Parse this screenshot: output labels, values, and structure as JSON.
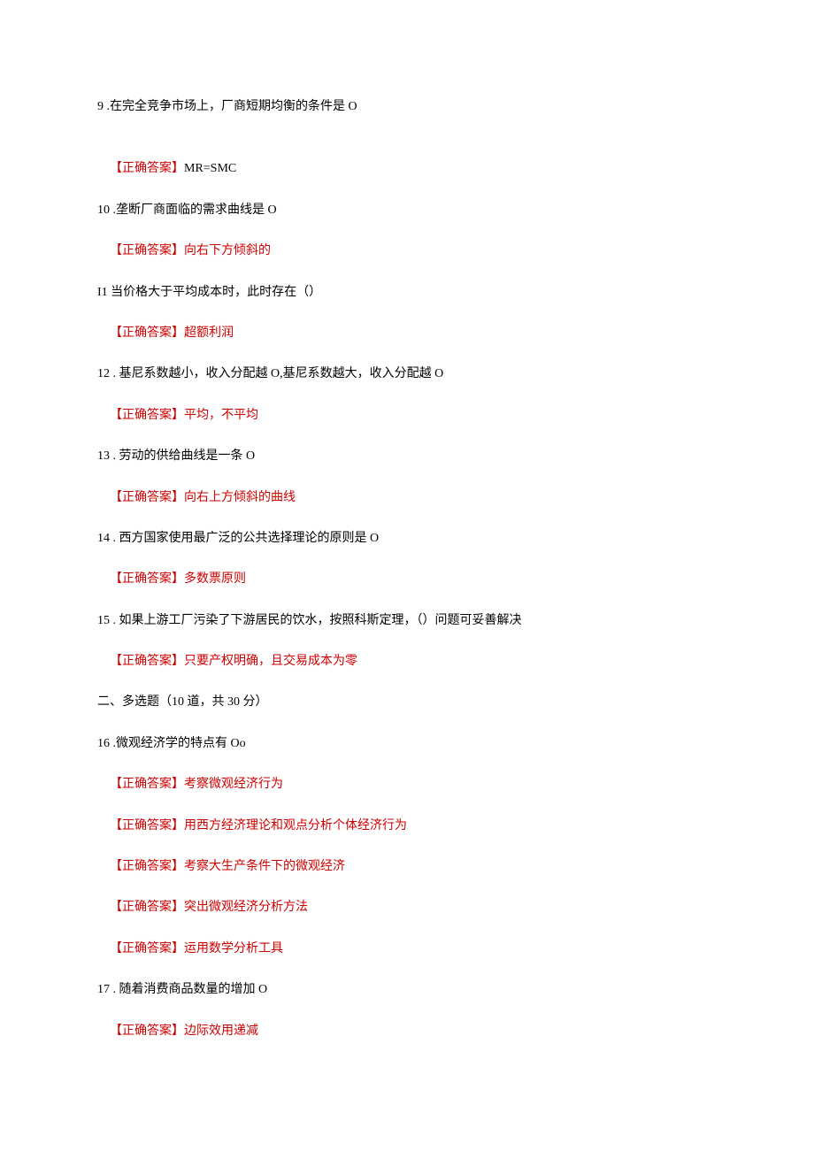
{
  "answer_label": "【正确答案】",
  "items": [
    {
      "type": "question",
      "number": "9",
      "text": " .在完全竞争市场上，厂商短期均衡的条件是 O",
      "extra_gap": true
    },
    {
      "type": "answer",
      "text": "MR=SMC",
      "red": false
    },
    {
      "type": "question",
      "number": "10",
      "text": " .垄断厂商面临的需求曲线是 O"
    },
    {
      "type": "answer",
      "text": "向右下方倾斜的",
      "red": true
    },
    {
      "type": "question",
      "number": "I1",
      "text": " 当价格大于平均成本时，此时存在（）"
    },
    {
      "type": "answer",
      "text": "超额利润",
      "red": true
    },
    {
      "type": "question",
      "number": "12",
      "text": " . 基尼系数越小，收入分配越 O,基尼系数越大，收入分配越 O"
    },
    {
      "type": "answer",
      "text": "平均，不平均",
      "red": true
    },
    {
      "type": "question",
      "number": "13",
      "text": " . 劳动的供给曲线是一条 O"
    },
    {
      "type": "answer",
      "text": "向右上方倾斜的曲线",
      "red": true
    },
    {
      "type": "question",
      "number": "14",
      "text": " . 西方国家使用最广泛的公共选择理论的原则是 O"
    },
    {
      "type": "answer",
      "text": "多数票原则",
      "red": true
    },
    {
      "type": "question",
      "number": "15",
      "text": " . 如果上游工厂污染了下游居民的饮水，按照科斯定理，（）问题可妥善解决"
    },
    {
      "type": "answer",
      "text": "只要产权明确，且交易成本为零",
      "red": true
    },
    {
      "type": "section",
      "text": "二、多选题（10 道，共 30 分）"
    },
    {
      "type": "question",
      "number": "16",
      "text": " .微观经济学的特点有 Oo"
    },
    {
      "type": "answer",
      "text": "考察微观经济行为",
      "red": true
    },
    {
      "type": "answer",
      "text": "用西方经济理论和观点分析个体经济行为",
      "red": true
    },
    {
      "type": "answer",
      "text": "考察大生产条件下的微观经济",
      "red": true
    },
    {
      "type": "answer",
      "text": "突出微观经济分析方法",
      "red": true
    },
    {
      "type": "answer",
      "text": "运用数学分析工具",
      "red": true
    },
    {
      "type": "question",
      "number": "17",
      "text": " . 随着消费商品数量的增加 O"
    },
    {
      "type": "answer",
      "text": "边际效用递减",
      "red": true
    }
  ]
}
